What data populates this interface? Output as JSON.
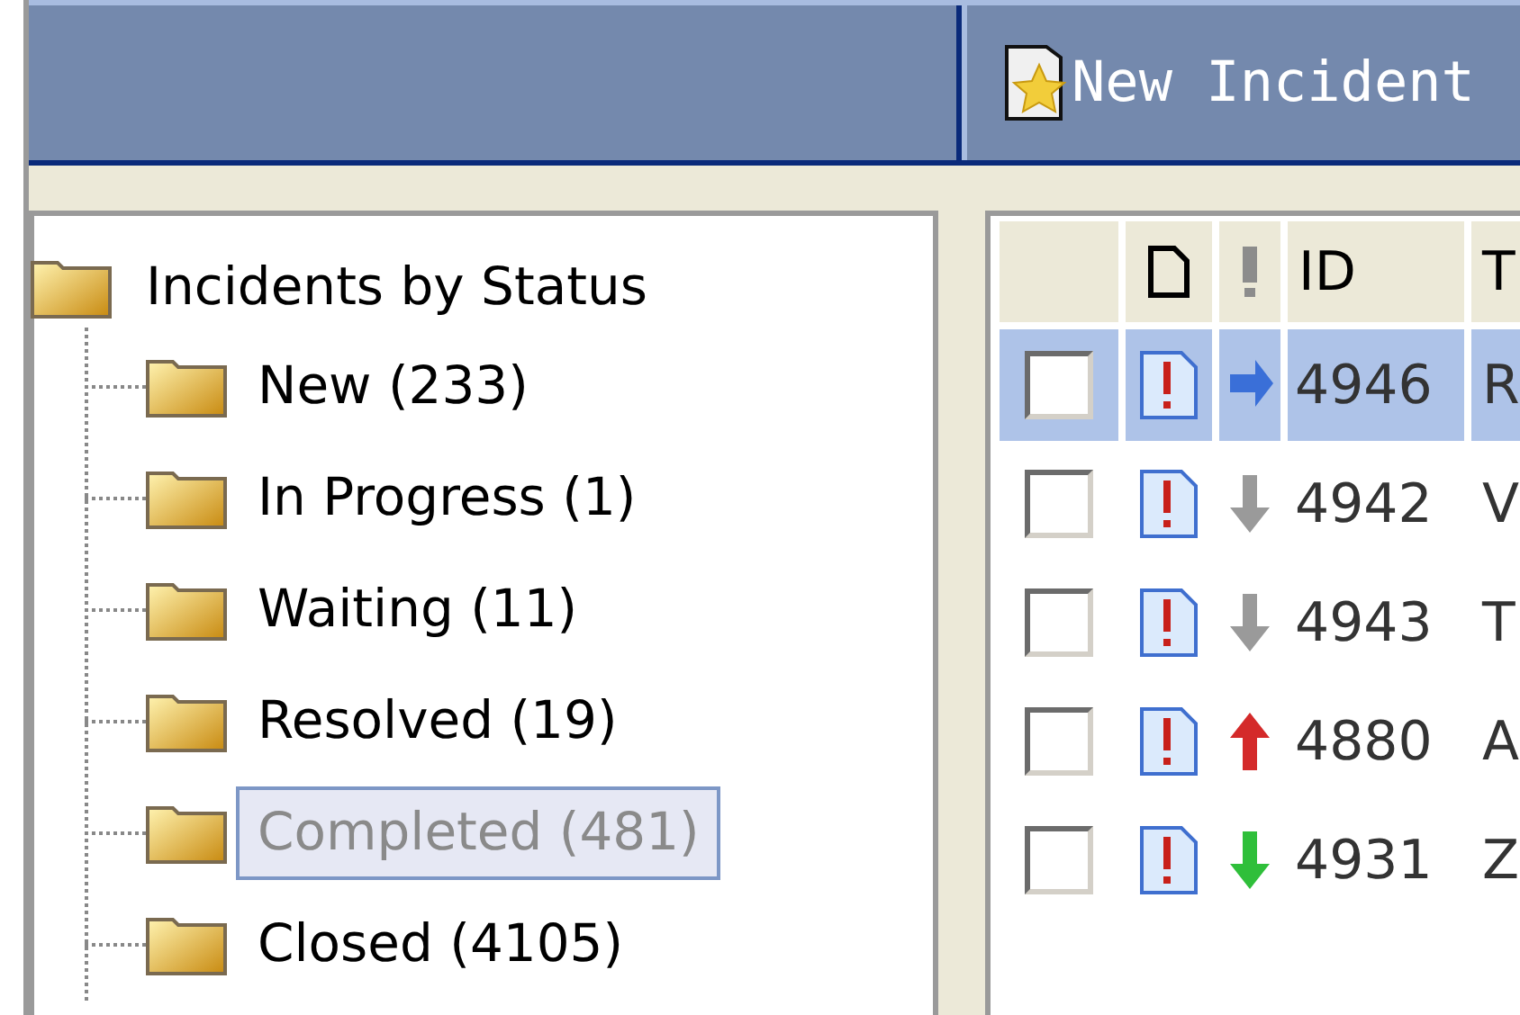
{
  "toolbar": {
    "new_button": "New Incident"
  },
  "tree": {
    "label": "Incidents by Status",
    "expanded": true,
    "children": [
      {
        "label": "New (233)",
        "selected": false
      },
      {
        "label": "In Progress (1)",
        "selected": false
      },
      {
        "label": "Waiting (11)",
        "selected": false
      },
      {
        "label": "Resolved (19)",
        "selected": false
      },
      {
        "label": "Completed (481)",
        "selected": true
      },
      {
        "label": "Closed (4105)",
        "selected": false
      }
    ]
  },
  "table": {
    "columns": [
      "ID",
      "T"
    ],
    "rows": [
      {
        "selected": true,
        "checked": false,
        "kind": "right",
        "color": "#3a6fd8",
        "id": "4946",
        "title": "R"
      },
      {
        "selected": false,
        "checked": false,
        "kind": "down",
        "color": "#9a9a9a",
        "id": "4942",
        "title": "V"
      },
      {
        "selected": false,
        "checked": false,
        "kind": "down",
        "color": "#9a9a9a",
        "id": "4943",
        "title": "T"
      },
      {
        "selected": false,
        "checked": false,
        "kind": "up",
        "color": "#d42a2a",
        "id": "4880",
        "title": "A"
      },
      {
        "selected": false,
        "checked": false,
        "kind": "down",
        "color": "#2fbf3a",
        "id": "4931",
        "title": "Z"
      }
    ]
  }
}
